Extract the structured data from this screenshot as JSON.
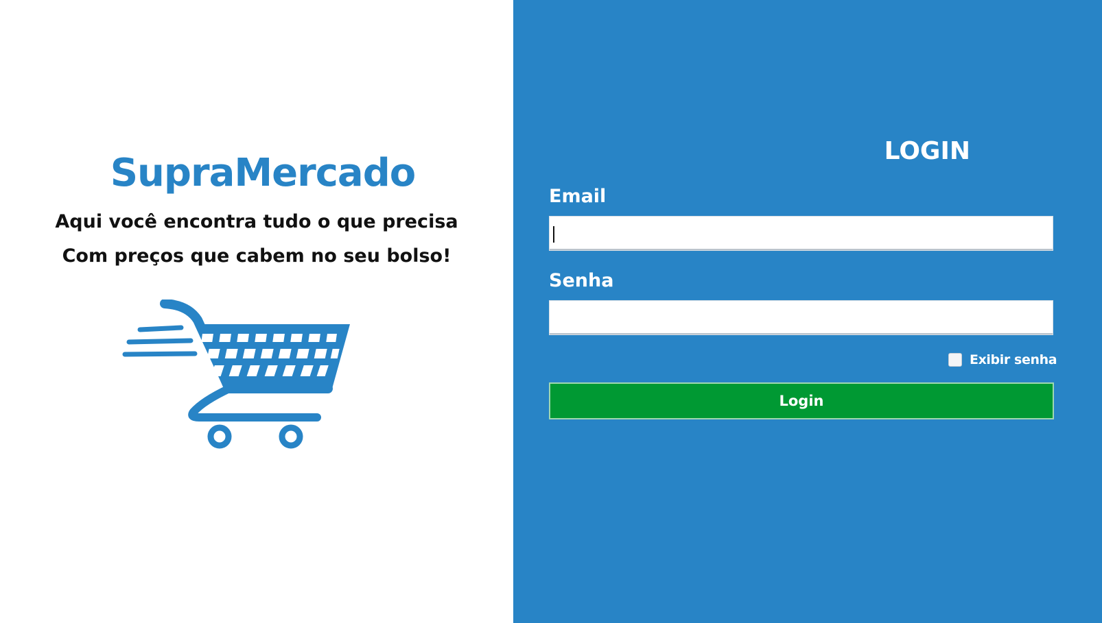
{
  "brand": {
    "name": "SupraMercado",
    "tagline_1": "Aqui você encontra tudo o que precisa",
    "tagline_2": "Com preços que cabem no seu bolso!",
    "logo_icon": "shopping-cart-icon"
  },
  "login": {
    "title": "LOGIN",
    "email_label": "Email",
    "email_value": "",
    "password_label": "Senha",
    "password_value": "",
    "show_password_label": "Exibir senha",
    "show_password_checked": false,
    "button_label": "Login"
  },
  "colors": {
    "brand_blue": "#2884C6",
    "panel_blue": "#2884C6",
    "button_green": "#009933",
    "tagline_text": "#111111"
  }
}
